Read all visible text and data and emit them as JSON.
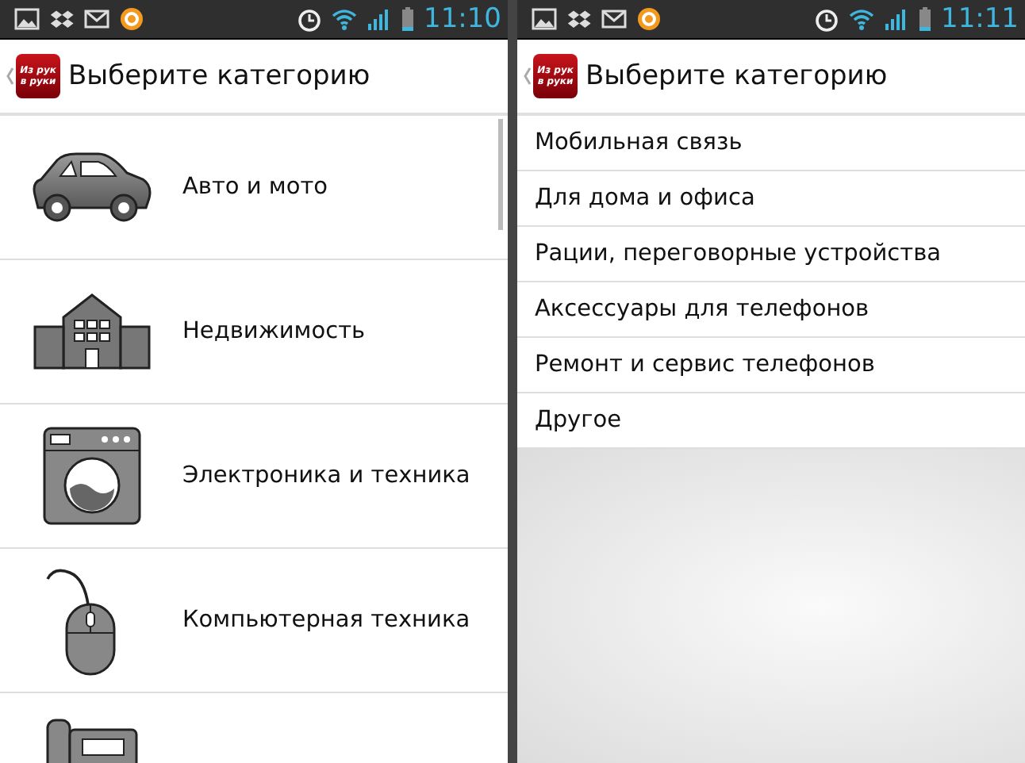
{
  "screens": [
    {
      "kind": "icons",
      "status_bar": {
        "time": "11:10"
      },
      "header": {
        "logo_text": "Из рук в руки",
        "title": "Выберите категорию"
      },
      "items": [
        {
          "label": "Авто и мото",
          "kind": "car"
        },
        {
          "label": "Недвижимость",
          "kind": "building"
        },
        {
          "label": "Электроника и техника",
          "kind": "washer"
        },
        {
          "label": "Компьютерная техника",
          "kind": "mouse"
        },
        {
          "kind": "phone"
        }
      ]
    },
    {
      "kind": "text",
      "status_bar": {
        "time": "11:11"
      },
      "header": {
        "logo_text": "Из рук в руки",
        "title": "Выберите категорию"
      },
      "items": [
        {
          "label": "Мобильная связь"
        },
        {
          "label": "Для дома и офиса"
        },
        {
          "label": "Рации, переговорные устройства"
        },
        {
          "label": "Аксессуары для телефонов"
        },
        {
          "label": "Ремонт и сервис телефонов"
        },
        {
          "label": "Другое"
        }
      ]
    }
  ]
}
